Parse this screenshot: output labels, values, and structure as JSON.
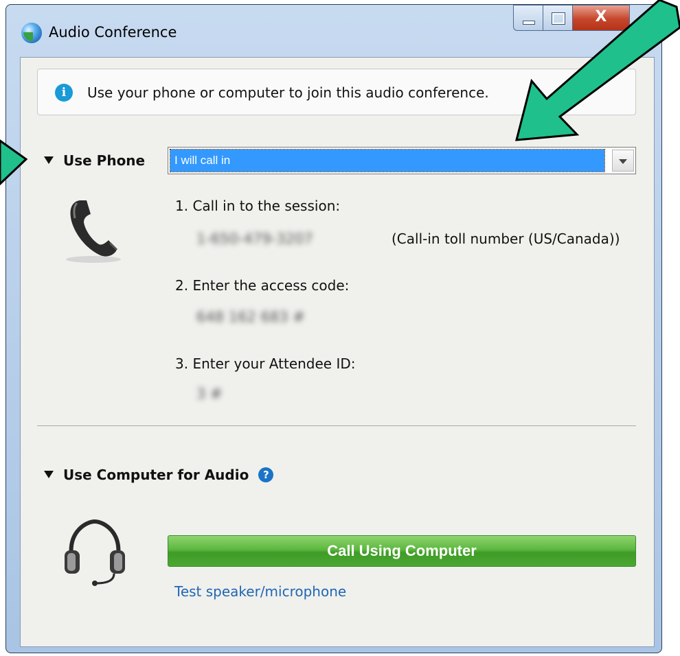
{
  "window": {
    "title": "Audio Conference",
    "controls": {
      "minimize": "minimize",
      "maximize": "maximize",
      "close": "X"
    }
  },
  "info": {
    "icon": "info-icon",
    "text": "Use your phone or computer to join this audio conference."
  },
  "phone_section": {
    "heading": "Use Phone",
    "dropdown": {
      "selected": "I will call in"
    },
    "steps": [
      {
        "label": "1. Call in to the session:",
        "value": "1-650-479-3207",
        "note": "(Call-in toll number (US/Canada))"
      },
      {
        "label": "2. Enter the access code:",
        "value": "648 162 683 #"
      },
      {
        "label": "3. Enter your Attendee ID:",
        "value": "3 #"
      }
    ]
  },
  "computer_section": {
    "heading": "Use Computer for Audio",
    "help_icon": "?",
    "call_button": "Call Using Computer",
    "test_link": "Test speaker/microphone"
  },
  "colors": {
    "accent_blue": "#3399ff",
    "call_button_green": "#4aa831",
    "annotation_arrow": "#1fc08c",
    "link_blue": "#1f66b4"
  }
}
